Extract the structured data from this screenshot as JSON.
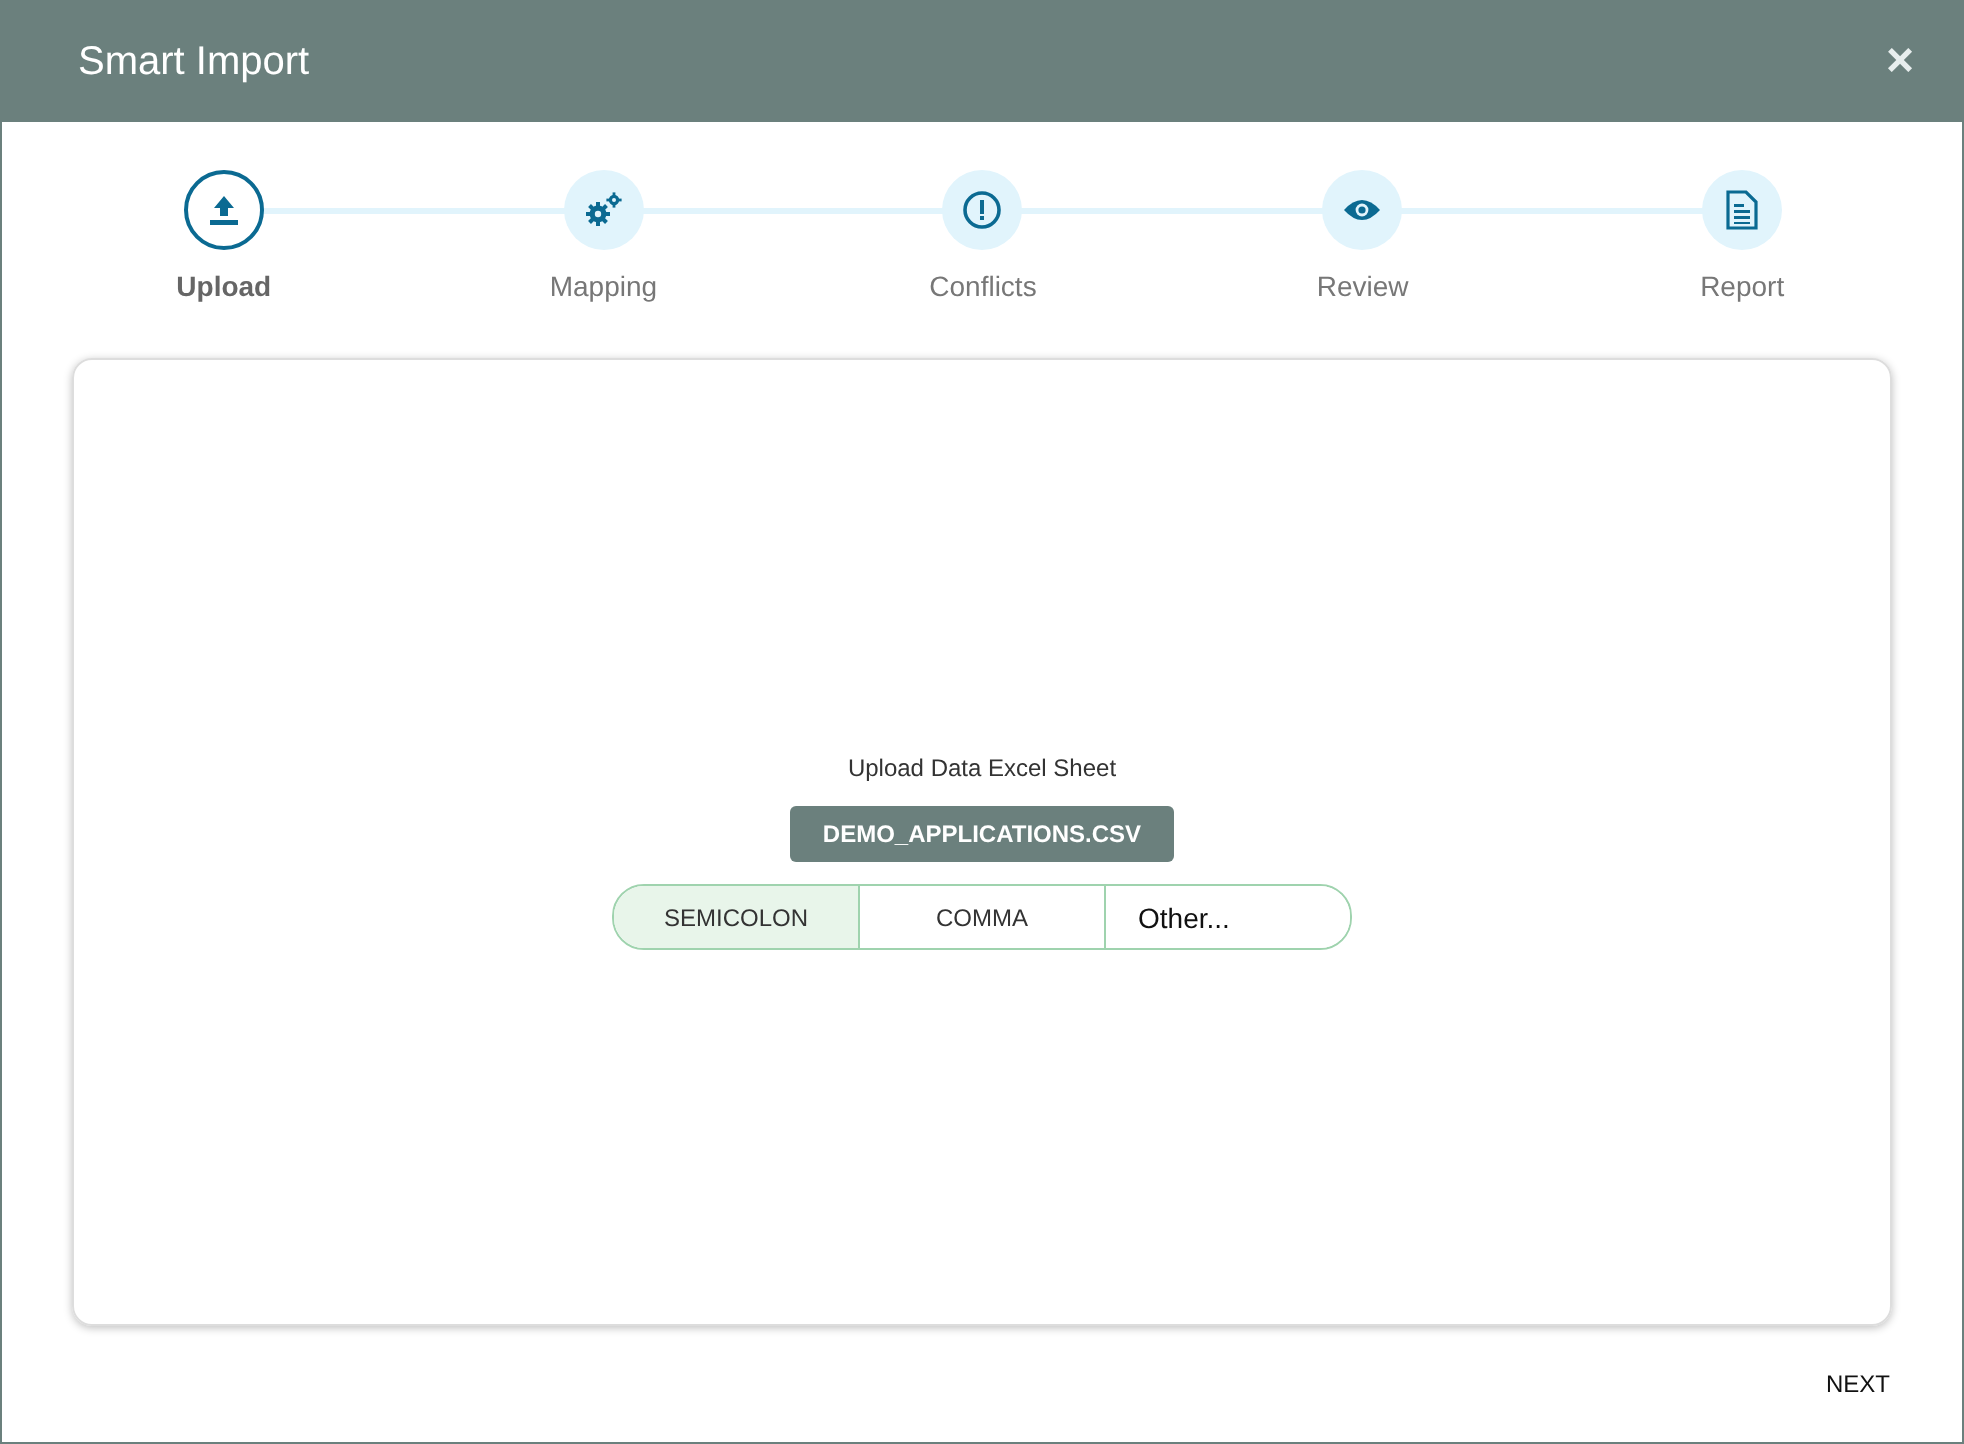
{
  "window": {
    "title": "Smart Import",
    "close": "×"
  },
  "steps": [
    {
      "label": "Upload",
      "selected": true
    },
    {
      "label": "Mapping",
      "selected": false
    },
    {
      "label": "Conflicts",
      "selected": false
    },
    {
      "label": "Review",
      "selected": false
    },
    {
      "label": "Report",
      "selected": false
    }
  ],
  "upload": {
    "prompt": "Upload Data Excel Sheet",
    "file_button": "DEMO_APPLICATIONS.CSV",
    "separators": [
      {
        "kind": "option",
        "label": "SEMICOLON",
        "selected": true
      },
      {
        "kind": "option",
        "label": "COMMA",
        "selected": false
      },
      {
        "kind": "input",
        "value": "Other..."
      }
    ]
  },
  "footer": {
    "next": "NEXT"
  }
}
